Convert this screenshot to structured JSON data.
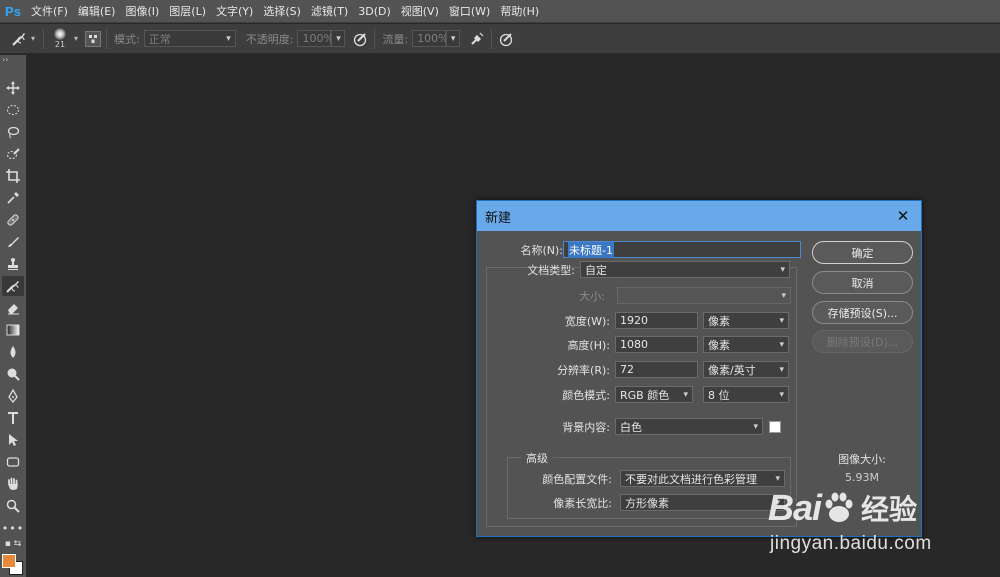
{
  "app": {
    "logo": "Ps"
  },
  "menu": [
    "文件(F)",
    "编辑(E)",
    "图像(I)",
    "图层(L)",
    "文字(Y)",
    "选择(S)",
    "滤镜(T)",
    "3D(D)",
    "视图(V)",
    "窗口(W)",
    "帮助(H)"
  ],
  "options": {
    "brush_size": "21",
    "mode_label": "模式:",
    "mode_value": "正常",
    "opacity_label": "不透明度:",
    "opacity_value": "100%",
    "flow_label": "流量:",
    "flow_value": "100%"
  },
  "tools": [
    "move-tool",
    "marquee-tool",
    "lasso-tool",
    "quick-select-tool",
    "crop-tool",
    "eyedropper-tool",
    "healing-tool",
    "brush-tool",
    "stamp-tool",
    "history-brush-tool",
    "eraser-tool",
    "gradient-tool",
    "blur-tool",
    "dodge-tool",
    "pen-tool",
    "type-tool",
    "path-select-tool",
    "shape-tool",
    "hand-tool",
    "zoom-tool",
    "more-tools"
  ],
  "colors": {
    "foreground": "#e8883a",
    "background": "#ffffff",
    "dialog_title": "#69a9e9"
  },
  "dialog": {
    "title": "新建",
    "name_label": "名称(N):",
    "name_value": "未标题-1",
    "doc_type_label": "文档类型:",
    "doc_type_value": "自定",
    "size_label": "大小:",
    "size_value": "",
    "width_label": "宽度(W):",
    "width_value": "1920",
    "width_unit": "像素",
    "height_label": "高度(H):",
    "height_value": "1080",
    "height_unit": "像素",
    "resolution_label": "分辨率(R):",
    "resolution_value": "72",
    "resolution_unit": "像素/英寸",
    "color_mode_label": "颜色模式:",
    "color_mode_value": "RGB 颜色",
    "bit_depth_value": "8 位",
    "bg_label": "背景内容:",
    "bg_value": "白色",
    "advanced_title": "高级",
    "profile_label": "颜色配置文件:",
    "profile_value": "不要对此文档进行色彩管理",
    "pixel_aspect_label": "像素长宽比:",
    "pixel_aspect_value": "方形像素",
    "buttons": {
      "ok": "确定",
      "cancel": "取消",
      "save_preset": "存储预设(S)...",
      "delete_preset": "删除预设(D)..."
    },
    "image_size_label": "图像大小:",
    "image_size_value": "5.93M"
  },
  "watermark": {
    "brand": "Bai",
    "brand_cn": "经验",
    "url": "jingyan.baidu.com"
  }
}
